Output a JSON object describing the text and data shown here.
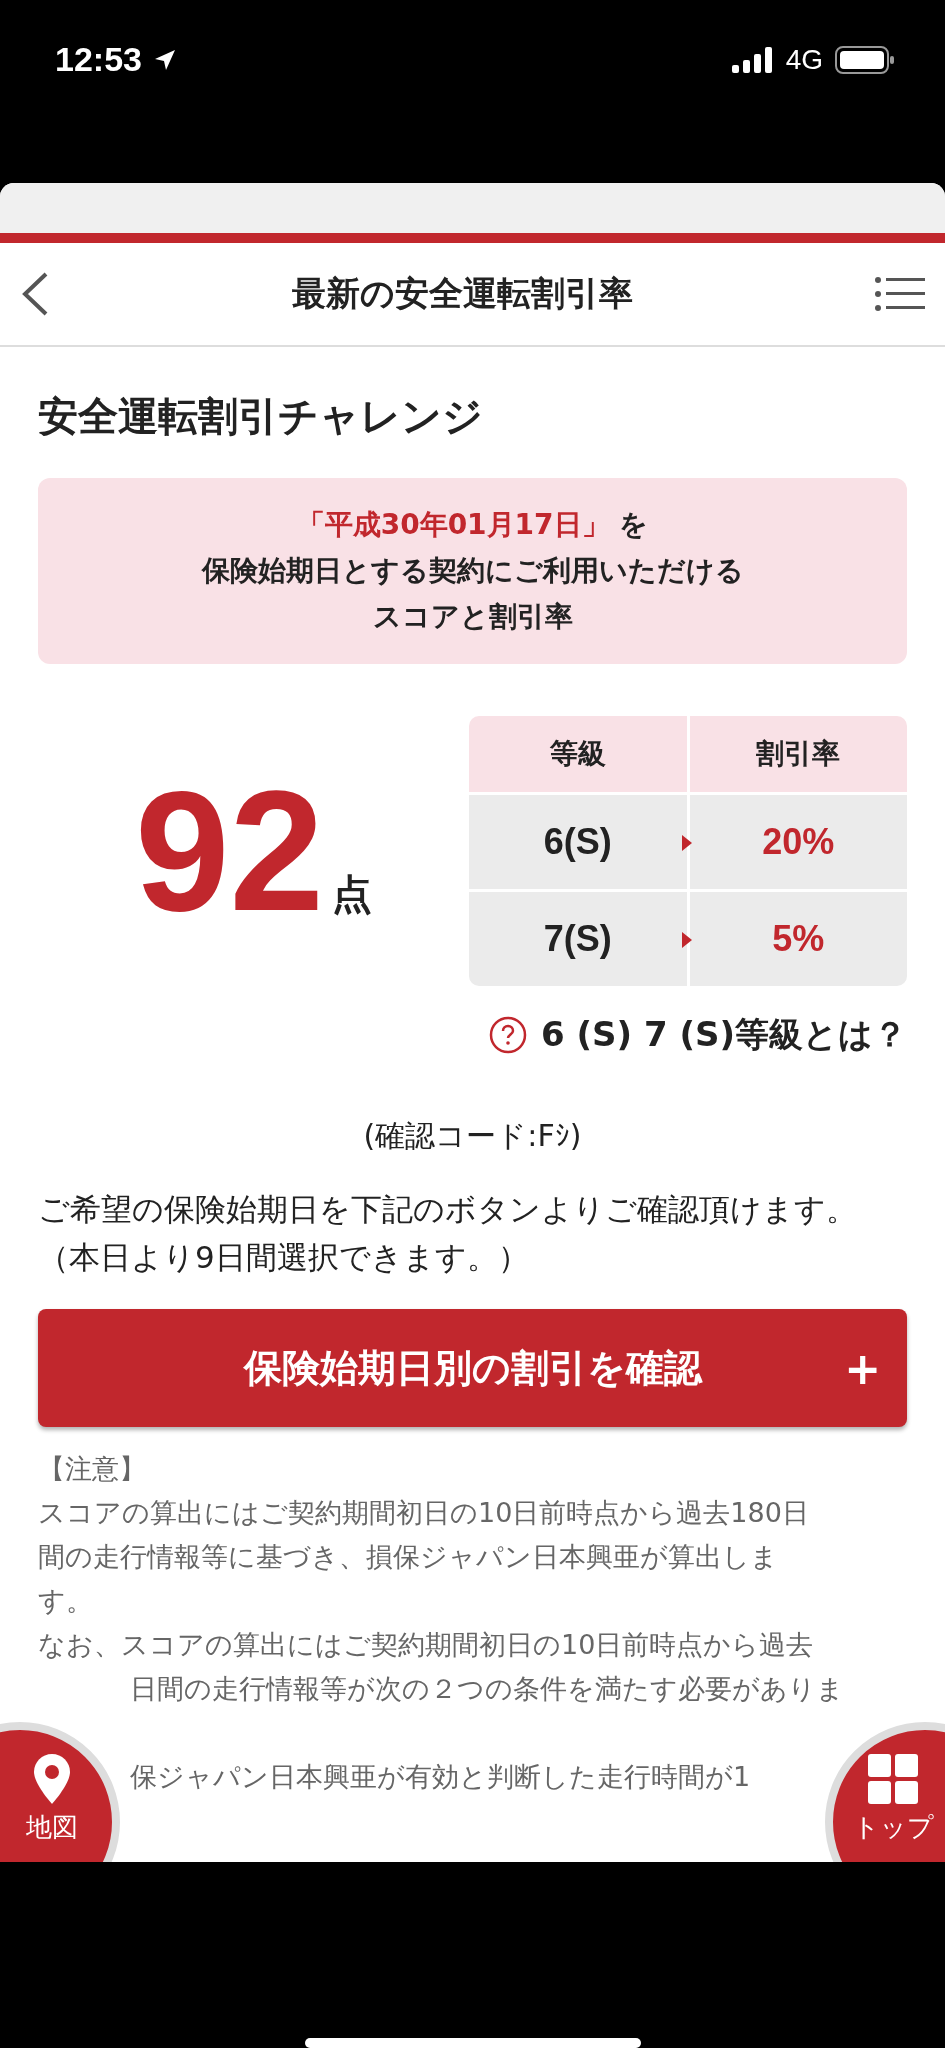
{
  "status_bar": {
    "time": "12:53",
    "network": "4G"
  },
  "header": {
    "title": "最新の安全運転割引率"
  },
  "section_title": "安全運転割引チャレンジ",
  "notice": {
    "date": "「平成30年01月17日」",
    "lines": [
      "を",
      "保険始期日とする契約にご利用いただける",
      "スコアと割引率"
    ]
  },
  "score": {
    "value": "92",
    "unit": "点"
  },
  "table": {
    "columns": [
      "等級",
      "割引率"
    ],
    "rows": [
      {
        "grade": "6(S)",
        "rate": "20%"
      },
      {
        "grade": "7(S)",
        "rate": "5%"
      }
    ]
  },
  "help_link": "6 (S) 7 (S)等級とは？",
  "code": "(確認コード:Fｼ)",
  "description": "ご希望の保険始期日を下記のボタンよりご確認頂けます。（本日より9日間選択できます。）",
  "action_button": {
    "label": "保険始期日別の割引を確認",
    "icon": "+"
  },
  "notes": [
    {
      "kind": "full",
      "text": "【注意】"
    },
    {
      "kind": "full",
      "text": "スコアの算出にはご契約期間初日の10日前時点から過去180日"
    },
    {
      "kind": "full",
      "text": "間の走行情報等に基づき、損保ジャパン日本興亜が算出しま"
    },
    {
      "kind": "full",
      "text": "す。"
    },
    {
      "kind": "full",
      "text": "なお、スコアの算出にはご契約期間初日の10日前時点から過去"
    },
    {
      "kind": "partial",
      "text": "日間の走行情報等が次の２つの条件を満たす必要がありま"
    },
    {
      "kind": "blank"
    },
    {
      "kind": "partial",
      "text": "保ジャパン日本興亜が有効と判断した走行時間が1"
    }
  ],
  "floating": [
    {
      "label": "地図"
    },
    {
      "label": "トップ"
    }
  ]
}
